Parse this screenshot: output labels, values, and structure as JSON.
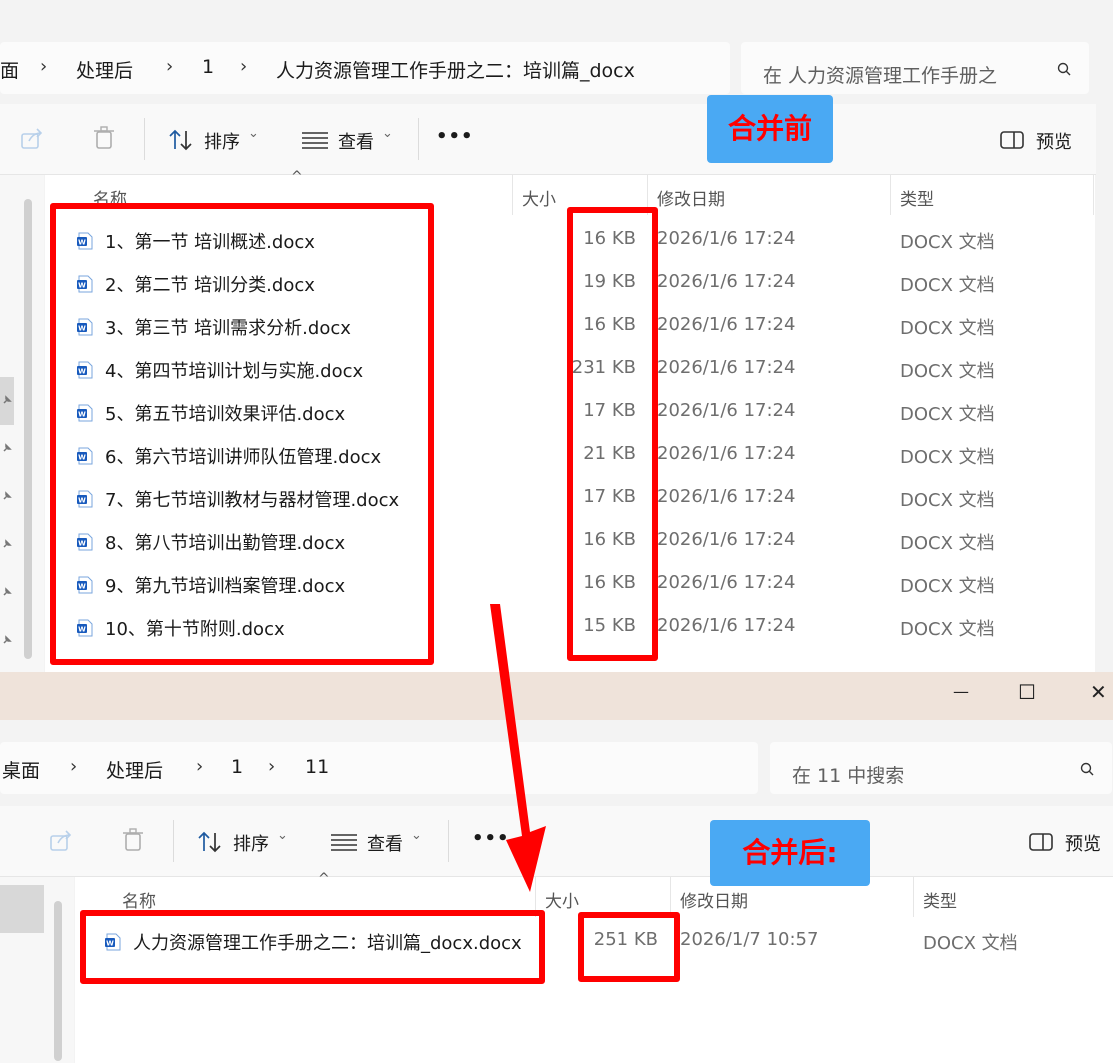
{
  "top": {
    "breadcrumbs": [
      "面",
      "处理后",
      "1",
      "人力资源管理工作手册之二：培训篇_docx"
    ],
    "search_placeholder": "在 人力资源管理工作手册之",
    "toolbar": {
      "sort": "排序",
      "view": "查看",
      "more": "•••",
      "preview": "预览"
    },
    "annotation": "合并前",
    "columns": {
      "name": "名称",
      "size": "大小",
      "date": "修改日期",
      "type": "类型"
    },
    "files": [
      {
        "name": "1、第一节 培训概述.docx",
        "size": "16 KB",
        "date": "2026/1/6 17:24",
        "type": "DOCX 文档"
      },
      {
        "name": "2、第二节 培训分类.docx",
        "size": "19 KB",
        "date": "2026/1/6 17:24",
        "type": "DOCX 文档"
      },
      {
        "name": "3、第三节 培训需求分析.docx",
        "size": "16 KB",
        "date": "2026/1/6 17:24",
        "type": "DOCX 文档"
      },
      {
        "name": "4、第四节培训计划与实施.docx",
        "size": "231 KB",
        "date": "2026/1/6 17:24",
        "type": "DOCX 文档"
      },
      {
        "name": "5、第五节培训效果评估.docx",
        "size": "17 KB",
        "date": "2026/1/6 17:24",
        "type": "DOCX 文档"
      },
      {
        "name": "6、第六节培训讲师队伍管理.docx",
        "size": "21 KB",
        "date": "2026/1/6 17:24",
        "type": "DOCX 文档"
      },
      {
        "name": "7、第七节培训教材与器材管理.docx",
        "size": "17 KB",
        "date": "2026/1/6 17:24",
        "type": "DOCX 文档"
      },
      {
        "name": "8、第八节培训出勤管理.docx",
        "size": "16 KB",
        "date": "2026/1/6 17:24",
        "type": "DOCX 文档"
      },
      {
        "name": "9、第九节培训档案管理.docx",
        "size": "16 KB",
        "date": "2026/1/6 17:24",
        "type": "DOCX 文档"
      },
      {
        "name": "10、第十节附则.docx",
        "size": "15 KB",
        "date": "2026/1/6 17:24",
        "type": "DOCX 文档"
      }
    ]
  },
  "bottom": {
    "breadcrumbs": [
      "桌面",
      "处理后",
      "1",
      "11"
    ],
    "search_placeholder": "在 11 中搜索",
    "toolbar": {
      "sort": "排序",
      "view": "查看",
      "more": "•••",
      "preview": "预览"
    },
    "annotation": "合并后:",
    "columns": {
      "name": "名称",
      "size": "大小",
      "date": "修改日期",
      "type": "类型"
    },
    "files": [
      {
        "name": "人力资源管理工作手册之二：培训篇_docx.docx",
        "size": "251 KB",
        "date": "2026/1/7 10:57",
        "type": "DOCX 文档"
      }
    ],
    "window_controls": {
      "minimize": "—",
      "maximize": "☐",
      "close": "✕"
    }
  },
  "colors": {
    "highlight": "#ff0000",
    "badge": "#4aa9f3",
    "word_blue": "#185abd"
  }
}
